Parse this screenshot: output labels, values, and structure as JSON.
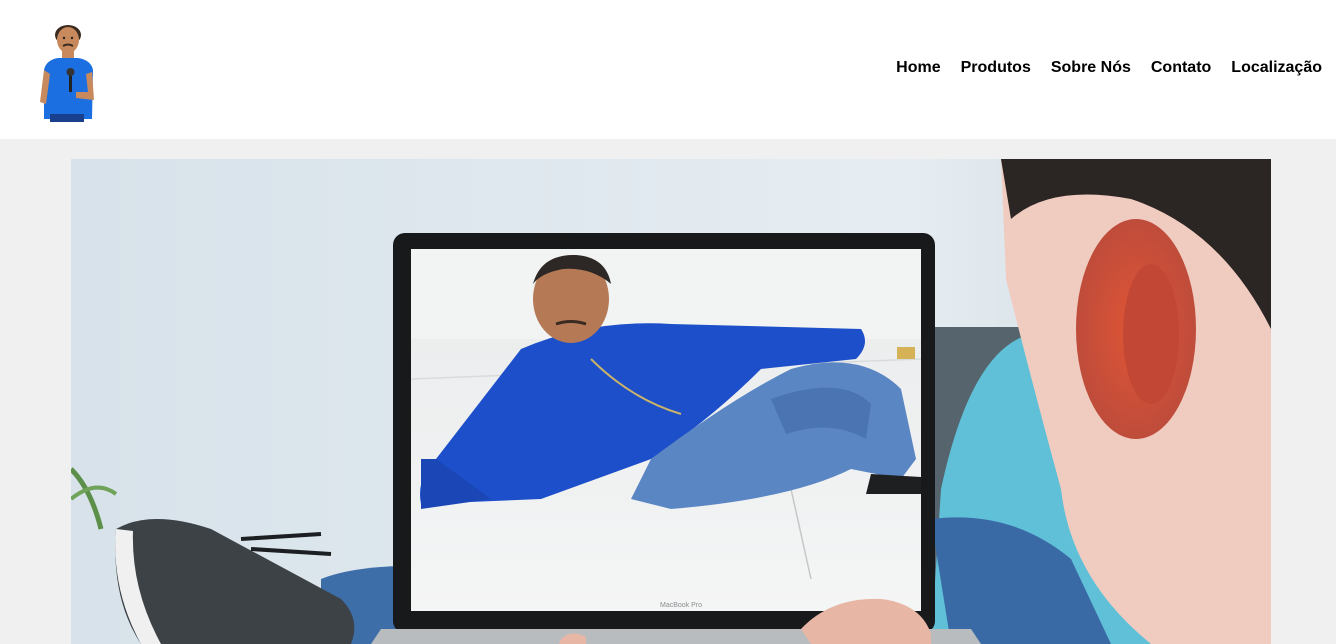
{
  "nav": {
    "items": [
      {
        "label": "Home"
      },
      {
        "label": "Produtos"
      },
      {
        "label": "Sobre Nós"
      },
      {
        "label": "Contato"
      },
      {
        "label": "Localização"
      }
    ]
  },
  "hero": {
    "laptop_brand": "MacBook Pro"
  },
  "colors": {
    "header_bg": "#ffffff",
    "page_bg": "#f0f0f0",
    "shirt_blue": "#1c4fc9"
  },
  "icons": {
    "logo": "cartoon-man-with-microphone-logo"
  }
}
